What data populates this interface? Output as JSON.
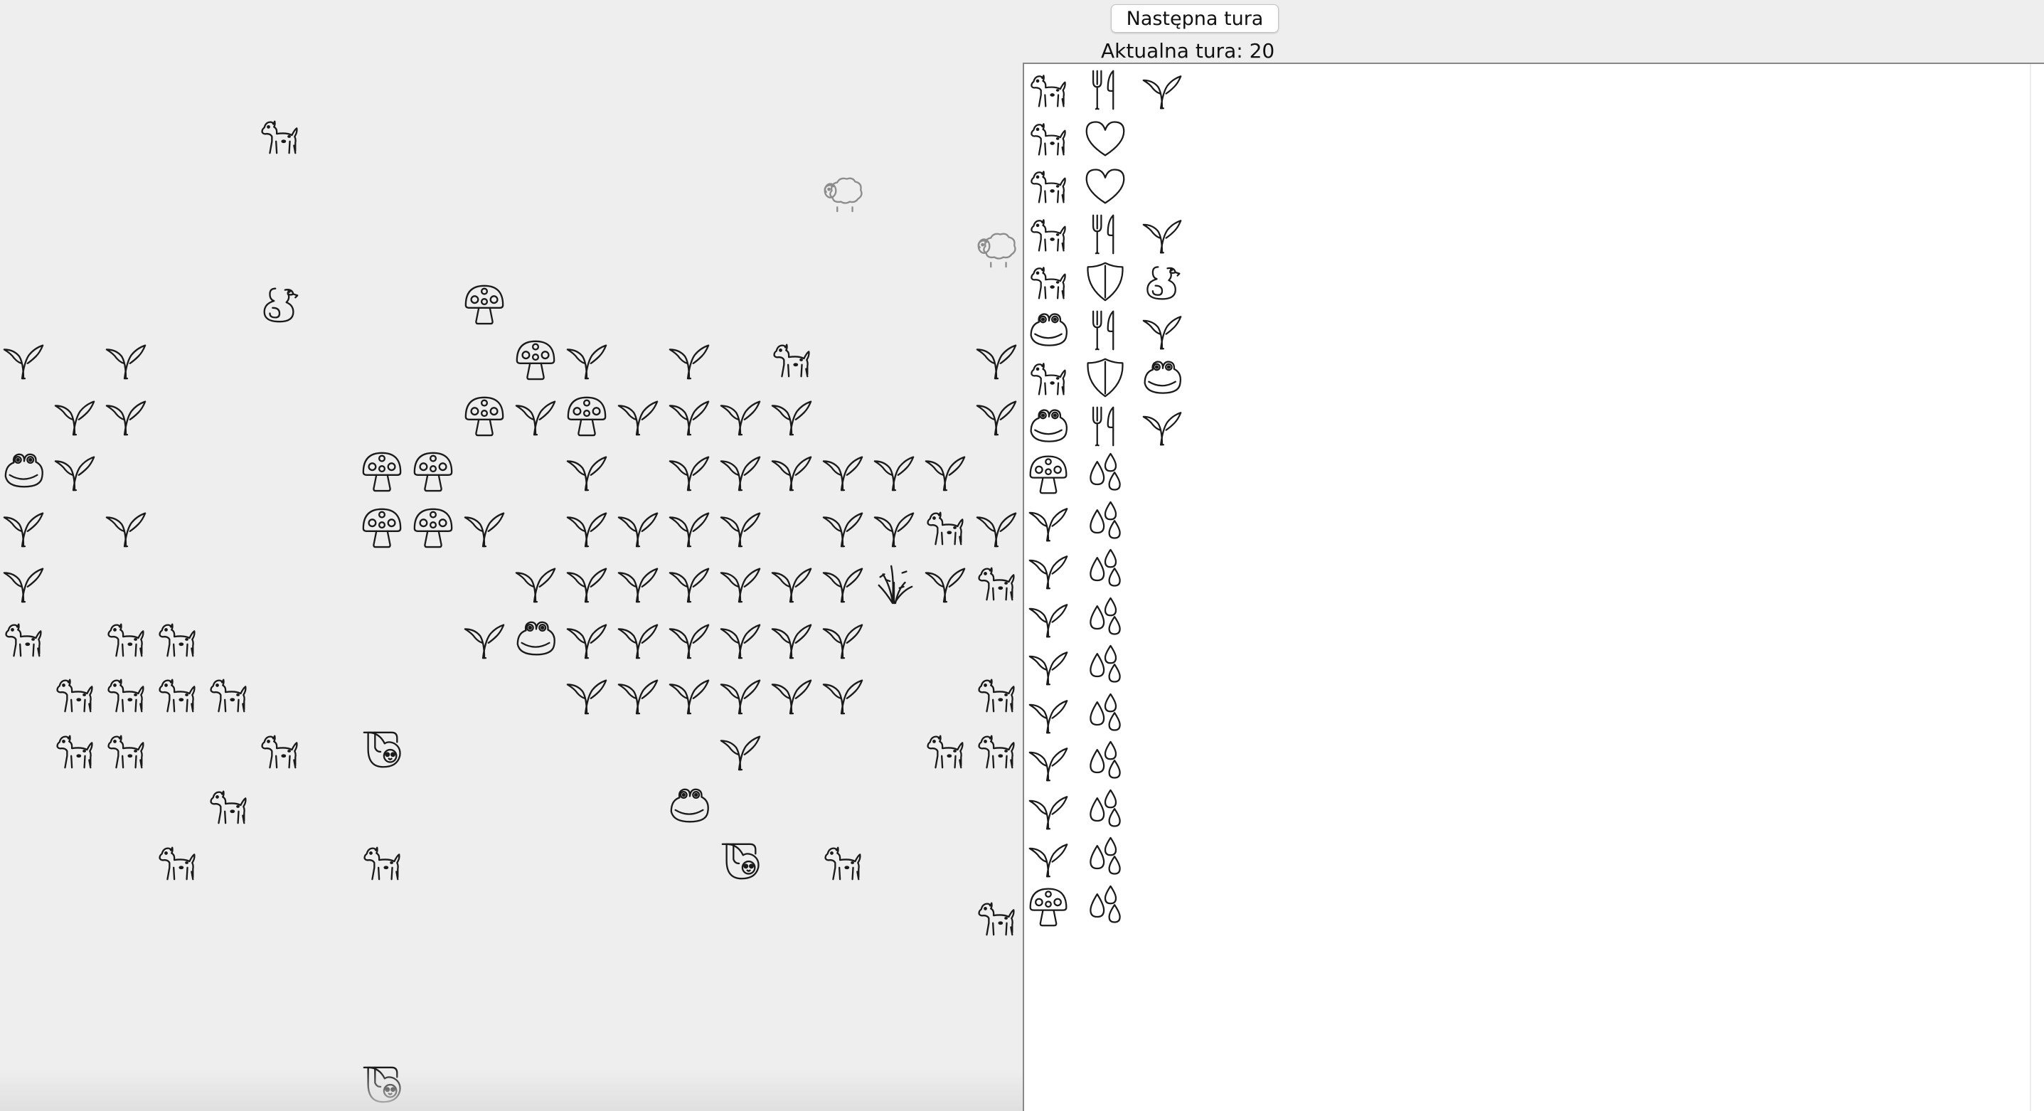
{
  "toolbar": {
    "next_turn_label": "Następna tura",
    "turn_label": "Aktualna tura: 20"
  },
  "board": {
    "organisms": [
      {
        "kind": "wolf",
        "col": 5,
        "row": 0
      },
      {
        "kind": "sheep",
        "col": 16,
        "row": 1
      },
      {
        "kind": "sheep",
        "col": 19,
        "row": 2
      },
      {
        "kind": "snake",
        "col": 5,
        "row": 3
      },
      {
        "kind": "mushroom",
        "col": 9,
        "row": 3
      },
      {
        "kind": "grass",
        "col": 0,
        "row": 4
      },
      {
        "kind": "grass",
        "col": 2,
        "row": 4
      },
      {
        "kind": "mushroom",
        "col": 10,
        "row": 4
      },
      {
        "kind": "grass",
        "col": 11,
        "row": 4
      },
      {
        "kind": "grass",
        "col": 13,
        "row": 4
      },
      {
        "kind": "wolf",
        "col": 15,
        "row": 4
      },
      {
        "kind": "grass",
        "col": 19,
        "row": 4
      },
      {
        "kind": "grass",
        "col": 1,
        "row": 5
      },
      {
        "kind": "grass",
        "col": 2,
        "row": 5
      },
      {
        "kind": "mushroom",
        "col": 9,
        "row": 5
      },
      {
        "kind": "grass",
        "col": 10,
        "row": 5
      },
      {
        "kind": "mushroom",
        "col": 11,
        "row": 5
      },
      {
        "kind": "grass",
        "col": 12,
        "row": 5
      },
      {
        "kind": "grass",
        "col": 13,
        "row": 5
      },
      {
        "kind": "grass",
        "col": 14,
        "row": 5
      },
      {
        "kind": "grass",
        "col": 15,
        "row": 5
      },
      {
        "kind": "grass",
        "col": 19,
        "row": 5
      },
      {
        "kind": "toad",
        "col": 0,
        "row": 6
      },
      {
        "kind": "grass",
        "col": 1,
        "row": 6
      },
      {
        "kind": "mushroom",
        "col": 7,
        "row": 6
      },
      {
        "kind": "mushroom",
        "col": 8,
        "row": 6
      },
      {
        "kind": "grass",
        "col": 11,
        "row": 6
      },
      {
        "kind": "grass",
        "col": 13,
        "row": 6
      },
      {
        "kind": "grass",
        "col": 14,
        "row": 6
      },
      {
        "kind": "grass",
        "col": 15,
        "row": 6
      },
      {
        "kind": "grass",
        "col": 16,
        "row": 6
      },
      {
        "kind": "grass",
        "col": 17,
        "row": 6
      },
      {
        "kind": "grass",
        "col": 18,
        "row": 6
      },
      {
        "kind": "grass",
        "col": 0,
        "row": 7
      },
      {
        "kind": "grass",
        "col": 2,
        "row": 7
      },
      {
        "kind": "mushroom",
        "col": 7,
        "row": 7
      },
      {
        "kind": "mushroom",
        "col": 8,
        "row": 7
      },
      {
        "kind": "grass",
        "col": 9,
        "row": 7
      },
      {
        "kind": "grass",
        "col": 11,
        "row": 7
      },
      {
        "kind": "grass",
        "col": 12,
        "row": 7
      },
      {
        "kind": "grass",
        "col": 13,
        "row": 7
      },
      {
        "kind": "grass",
        "col": 14,
        "row": 7
      },
      {
        "kind": "grass",
        "col": 16,
        "row": 7
      },
      {
        "kind": "grass",
        "col": 17,
        "row": 7
      },
      {
        "kind": "wolf",
        "col": 18,
        "row": 7
      },
      {
        "kind": "grass",
        "col": 19,
        "row": 7
      },
      {
        "kind": "grass",
        "col": 0,
        "row": 8
      },
      {
        "kind": "grass",
        "col": 10,
        "row": 8
      },
      {
        "kind": "grass",
        "col": 11,
        "row": 8
      },
      {
        "kind": "grass",
        "col": 12,
        "row": 8
      },
      {
        "kind": "grass",
        "col": 13,
        "row": 8
      },
      {
        "kind": "grass",
        "col": 14,
        "row": 8
      },
      {
        "kind": "grass",
        "col": 15,
        "row": 8
      },
      {
        "kind": "grass",
        "col": 16,
        "row": 8
      },
      {
        "kind": "hogweed",
        "col": 17,
        "row": 8
      },
      {
        "kind": "grass",
        "col": 18,
        "row": 8
      },
      {
        "kind": "wolf",
        "col": 19,
        "row": 8
      },
      {
        "kind": "wolf",
        "col": 0,
        "row": 9
      },
      {
        "kind": "wolf",
        "col": 2,
        "row": 9
      },
      {
        "kind": "wolf",
        "col": 3,
        "row": 9
      },
      {
        "kind": "grass",
        "col": 9,
        "row": 9
      },
      {
        "kind": "toad",
        "col": 10,
        "row": 9
      },
      {
        "kind": "grass",
        "col": 11,
        "row": 9
      },
      {
        "kind": "grass",
        "col": 12,
        "row": 9
      },
      {
        "kind": "grass",
        "col": 13,
        "row": 9
      },
      {
        "kind": "grass",
        "col": 14,
        "row": 9
      },
      {
        "kind": "grass",
        "col": 15,
        "row": 9
      },
      {
        "kind": "grass",
        "col": 16,
        "row": 9
      },
      {
        "kind": "wolf",
        "col": 1,
        "row": 10
      },
      {
        "kind": "wolf",
        "col": 2,
        "row": 10
      },
      {
        "kind": "wolf",
        "col": 3,
        "row": 10
      },
      {
        "kind": "wolf",
        "col": 4,
        "row": 10
      },
      {
        "kind": "grass",
        "col": 11,
        "row": 10
      },
      {
        "kind": "grass",
        "col": 12,
        "row": 10
      },
      {
        "kind": "grass",
        "col": 13,
        "row": 10
      },
      {
        "kind": "grass",
        "col": 14,
        "row": 10
      },
      {
        "kind": "grass",
        "col": 15,
        "row": 10
      },
      {
        "kind": "grass",
        "col": 16,
        "row": 10
      },
      {
        "kind": "wolf",
        "col": 19,
        "row": 10
      },
      {
        "kind": "wolf",
        "col": 1,
        "row": 11
      },
      {
        "kind": "wolf",
        "col": 2,
        "row": 11
      },
      {
        "kind": "wolf",
        "col": 5,
        "row": 11
      },
      {
        "kind": "sloth",
        "col": 7,
        "row": 11
      },
      {
        "kind": "grass",
        "col": 14,
        "row": 11
      },
      {
        "kind": "wolf",
        "col": 18,
        "row": 11
      },
      {
        "kind": "wolf",
        "col": 19,
        "row": 11
      },
      {
        "kind": "wolf",
        "col": 4,
        "row": 12
      },
      {
        "kind": "toad",
        "col": 13,
        "row": 12
      },
      {
        "kind": "wolf",
        "col": 3,
        "row": 13
      },
      {
        "kind": "wolf",
        "col": 7,
        "row": 13
      },
      {
        "kind": "sloth",
        "col": 14,
        "row": 13
      },
      {
        "kind": "wolf",
        "col": 16,
        "row": 13
      },
      {
        "kind": "wolf",
        "col": 19,
        "row": 14
      },
      {
        "kind": "sloth",
        "col": 7,
        "row": 17
      }
    ]
  },
  "log": [
    [
      "wolf",
      "fork-knife",
      "grass"
    ],
    [
      "wolf",
      "heart"
    ],
    [
      "wolf",
      "heart"
    ],
    [
      "wolf",
      "fork-knife",
      "grass"
    ],
    [
      "wolf",
      "shield",
      "snake"
    ],
    [
      "toad",
      "fork-knife",
      "grass"
    ],
    [
      "wolf",
      "shield",
      "toad"
    ],
    [
      "toad",
      "fork-knife",
      "grass"
    ],
    [
      "mushroom",
      "drops"
    ],
    [
      "grass",
      "drops"
    ],
    [
      "grass",
      "drops"
    ],
    [
      "grass",
      "drops"
    ],
    [
      "grass",
      "drops"
    ],
    [
      "grass",
      "drops"
    ],
    [
      "grass",
      "drops"
    ],
    [
      "grass",
      "drops"
    ],
    [
      "grass",
      "drops"
    ],
    [
      "mushroom",
      "drops"
    ]
  ]
}
